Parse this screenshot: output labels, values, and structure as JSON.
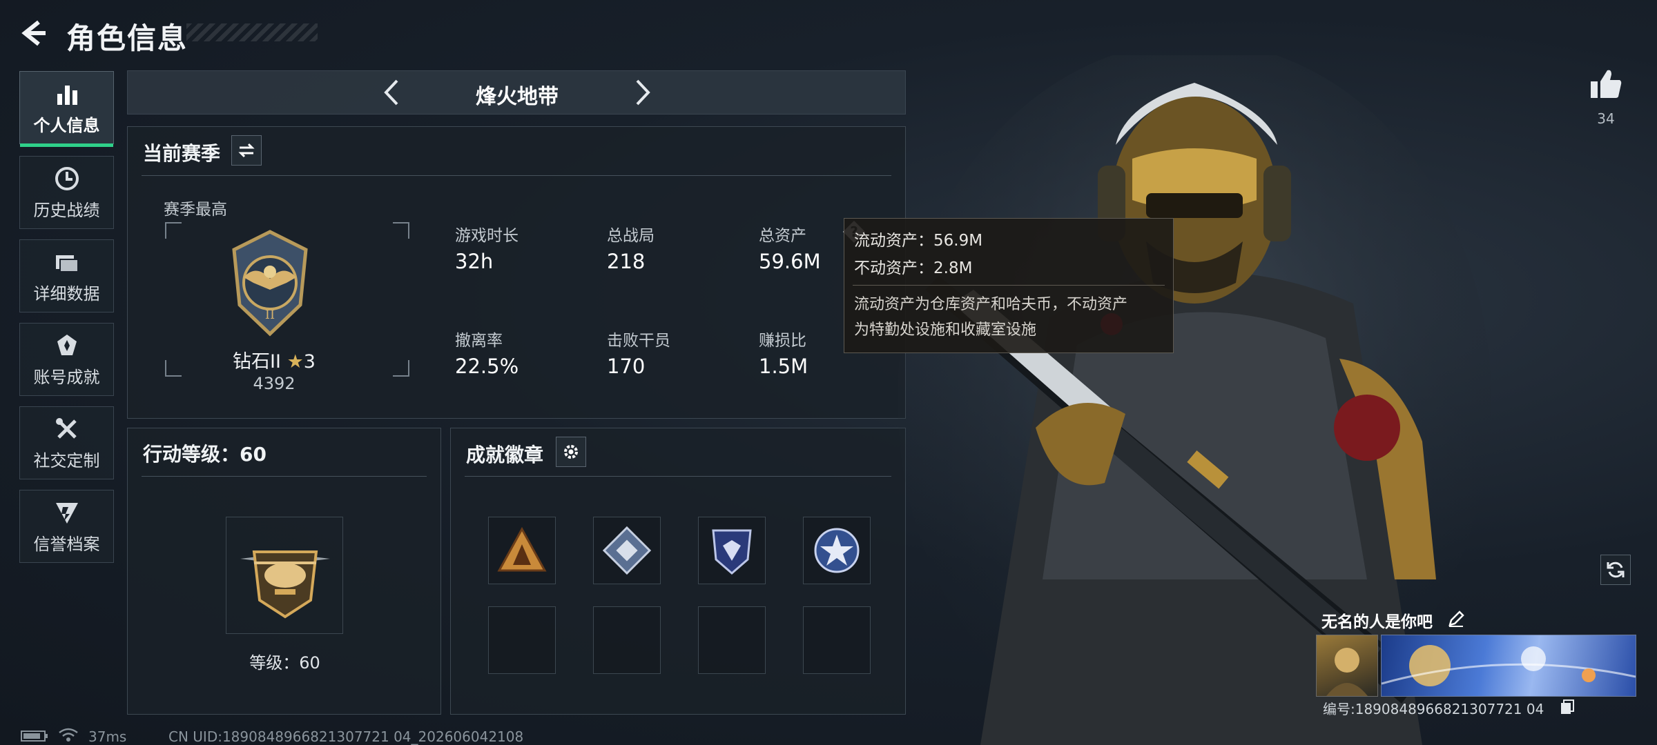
{
  "header": {
    "title": "角色信息"
  },
  "sidebar": {
    "items": [
      {
        "label": "个人信息",
        "icon": "bar-chart-icon",
        "active": true
      },
      {
        "label": "历史战绩",
        "icon": "history-icon"
      },
      {
        "label": "详细数据",
        "icon": "folder-icon"
      },
      {
        "label": "账号成就",
        "icon": "achievement-icon"
      },
      {
        "label": "社交定制",
        "icon": "tools-icon"
      },
      {
        "label": "信誉档案",
        "icon": "shield-icon"
      }
    ]
  },
  "mode": {
    "title": "烽火地带"
  },
  "season": {
    "title": "当前赛季",
    "best_label": "赛季最高",
    "rank_name": "钻石II",
    "rank_stars": "3",
    "rank_score": "4392",
    "stats": [
      {
        "label": "游戏时长",
        "value": "32h"
      },
      {
        "label": "总战局",
        "value": "218"
      },
      {
        "label": "总资产",
        "value": "59.6M"
      },
      {
        "label": "撤离率",
        "value": "22.5%"
      },
      {
        "label": "击败干员",
        "value": "170"
      },
      {
        "label": "赚损比",
        "value": "1.5M"
      }
    ]
  },
  "tooltip": {
    "line1": "流动资产：56.9M",
    "line2": "不动资产：2.8M",
    "desc1": "流动资产为仓库资产和哈夫币，不动资产",
    "desc2": "为特勤处设施和收藏室设施"
  },
  "action_level": {
    "title": "行动等级：60",
    "level_text": "等级：60"
  },
  "badges": {
    "title": "成就徽章"
  },
  "profile": {
    "likes": "34",
    "name": "无名的人是你吧",
    "id_text": "编号:1890848966821307721 04"
  },
  "status": {
    "ping": "37ms",
    "uid": "CN UID:1890848966821307721 04_202606042108"
  },
  "colors": {
    "accent": "#2fd18a",
    "panel": "#1a2128",
    "tooltip_bg": "#1c1a16"
  }
}
